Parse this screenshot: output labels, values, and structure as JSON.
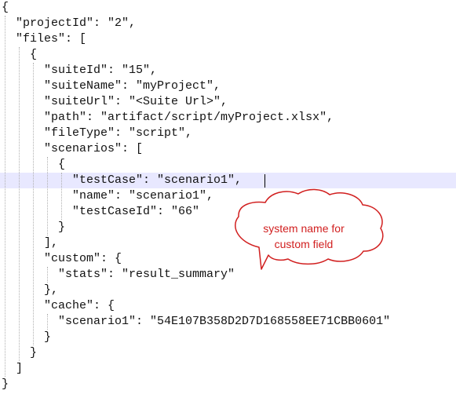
{
  "editor": {
    "lines": [
      "{",
      "  \"projectId\": \"2\",",
      "  \"files\": [",
      "    {",
      "      \"suiteId\": \"15\",",
      "      \"suiteName\": \"myProject\",",
      "      \"suiteUrl\": \"<Suite Url>\",",
      "      \"path\": \"artifact/script/myProject.xlsx\",",
      "      \"fileType\": \"script\",",
      "      \"scenarios\": [",
      "        {",
      "          \"testCase\": \"scenario1\",",
      "          \"name\": \"scenario1\",",
      "          \"testCaseId\": \"66\"",
      "        }",
      "      ],",
      "      \"custom\": {",
      "        \"stats\": \"result_summary\"",
      "      },",
      "      \"cache\": {",
      "        \"scenario1\": \"54E107B358D2D7D168558EE71CBB0601\"",
      "      }",
      "    }",
      "  ]",
      "}"
    ],
    "current_line": 11
  },
  "callout": {
    "line1": "system name for",
    "line2": "custom field",
    "stroke_color": "#d11f1f",
    "text_color": "#d11f1f"
  },
  "colors": {
    "background": "#ffffff",
    "current_line_highlight": "#e8e8ff",
    "guide": "#b0b0b0"
  }
}
